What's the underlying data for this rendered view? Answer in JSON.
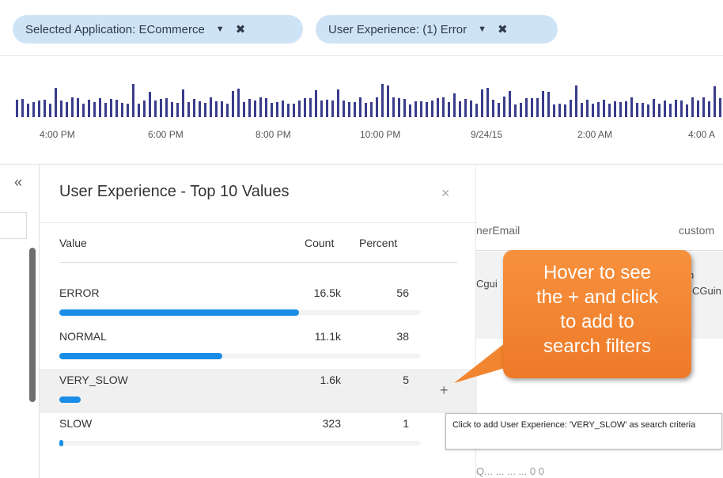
{
  "filters": {
    "app_label": "Selected Application:",
    "app_value": "ECommerce",
    "ux_label": "User Experience:",
    "ux_value": "(1) Error"
  },
  "timeline": {
    "ticks": [
      "4:00 PM",
      "6:00 PM",
      "8:00 PM",
      "10:00 PM",
      "9/24/15",
      "2:00 AM",
      "4:00 A"
    ],
    "bar_color": "#3a3c8c"
  },
  "table": {
    "collapse_glyph": "«",
    "columns": [
      "nerEmail",
      "custom"
    ],
    "row_fragments": [
      "Cgui",
      "n",
      "CGuin"
    ],
    "bottom_fragment": "Q...  ...  ...  ...  0  0"
  },
  "panel": {
    "title": "User Experience - Top 10 Values",
    "close_glyph": "×",
    "headers": {
      "value": "Value",
      "count": "Count",
      "percent": "Percent"
    },
    "rows": [
      {
        "name": "ERROR",
        "count": "16.5k",
        "percent": "56",
        "fraction": 0.56
      },
      {
        "name": "NORMAL",
        "count": "11.1k",
        "percent": "38",
        "fraction": 0.38
      },
      {
        "name": "VERY_SLOW",
        "count": "1.6k",
        "percent": "5",
        "fraction": 0.05
      },
      {
        "name": "SLOW",
        "count": "323",
        "percent": "1",
        "fraction": 0.01
      }
    ],
    "bar_color": "#1a8ee6"
  },
  "plus_glyph": "+",
  "tooltip": {
    "text": "Click to add User Experience: 'VERY_SLOW' as search criteria"
  },
  "callout": {
    "lines": [
      "Hover to see",
      "the + and click",
      "to add to",
      "search filters"
    ],
    "color": "#f2852f"
  }
}
